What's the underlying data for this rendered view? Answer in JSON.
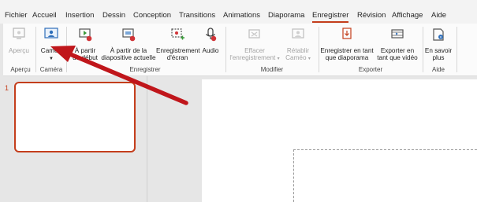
{
  "menu": {
    "tabs": [
      "Fichier",
      "Accueil",
      "Insertion",
      "Dessin",
      "Conception",
      "Transitions",
      "Animations",
      "Diaporama",
      "Enregistrer",
      "Révision",
      "Affichage",
      "Aide"
    ],
    "active_tab": "Enregistrer"
  },
  "ribbon": {
    "apercu": {
      "label": "Aperçu",
      "group": "Aperçu"
    },
    "camera": {
      "label": "Cameo",
      "group": "Caméra"
    },
    "enregistrer": {
      "group": "Enregistrer",
      "a_partir_debut": [
        "À partir",
        "du début"
      ],
      "a_partir_diapo": [
        "À partir de la",
        "diapositive actuelle"
      ],
      "enregistrement_ecran": [
        "Enregistrement",
        "d'écran"
      ],
      "audio": "Audio"
    },
    "modifier": {
      "group": "Modifier",
      "effacer": [
        "Effacer",
        "l'enregistrement"
      ],
      "retablir": [
        "Rétablir",
        "Caméo"
      ]
    },
    "exporter": {
      "group": "Exporter",
      "diaporama": [
        "Enregistrer en tant",
        "que diaporama"
      ],
      "video": [
        "Exporter en",
        "tant que vidéo"
      ]
    },
    "aide": {
      "group": "Aide",
      "en_savoir": [
        "En savoir",
        "plus"
      ]
    }
  },
  "slides": {
    "current_number": "1"
  },
  "colors": {
    "accent": "#c43e1c",
    "arrow": "#c0161b"
  }
}
